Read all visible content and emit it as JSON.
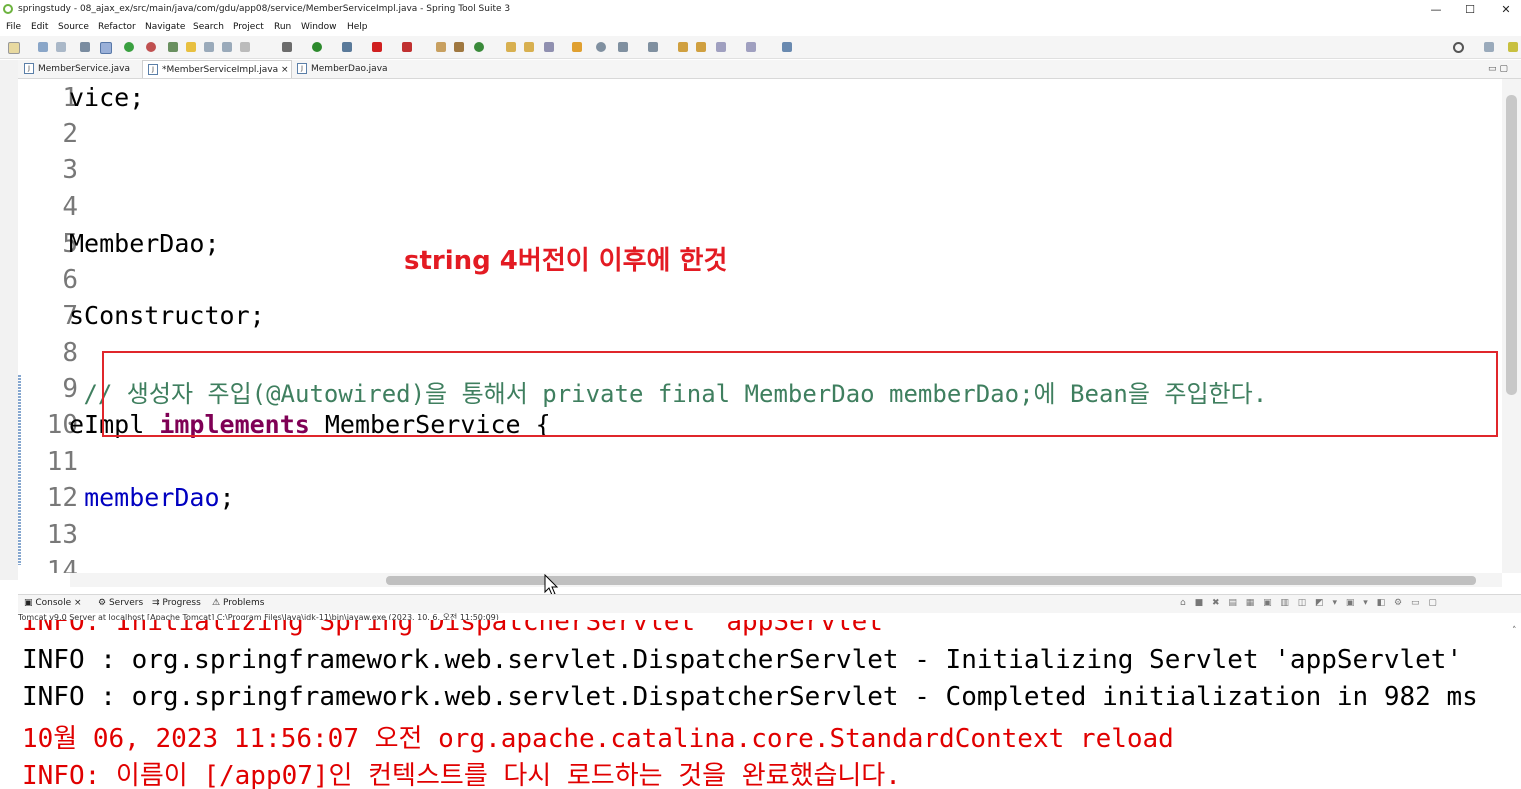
{
  "window": {
    "title": "springstudy - 08_ajax_ex/src/main/java/com/gdu/app08/service/MemberServiceImpl.java - Spring Tool Suite 3",
    "controls": [
      "—",
      "☐",
      "✕"
    ]
  },
  "menu": [
    "File",
    "Edit",
    "Source",
    "Refactor",
    "Navigate",
    "Search",
    "Project",
    "Run",
    "Window",
    "Help"
  ],
  "editor_tabs": [
    {
      "label": "MemberService.java",
      "active": false
    },
    {
      "label": "*MemberServiceImpl.java",
      "active": true,
      "close": "×"
    },
    {
      "label": "MemberDao.java",
      "active": false
    }
  ],
  "code_lines": [
    {
      "num": "1",
      "text": "vice;"
    },
    {
      "num": "2",
      "text": ""
    },
    {
      "num": "3",
      "text": ""
    },
    {
      "num": "4",
      "text": ""
    },
    {
      "num": "5",
      "text": "MemberDao;"
    },
    {
      "num": "6",
      "text": ""
    },
    {
      "num": "7",
      "text": "sConstructor;"
    },
    {
      "num": "8",
      "text": ""
    },
    {
      "num": "9",
      "text": " // 생성자 주입(@Autowired)을 통해서 private final MemberDao memberDao;에 Bean을 주입한다."
    },
    {
      "num": "10",
      "pre": "eImpl ",
      "kw": "implements",
      "post": " MemberService {"
    },
    {
      "num": "11",
      "text": ""
    },
    {
      "num": "12",
      "pre": " ",
      "fld": "memberDao",
      "post": ";"
    },
    {
      "num": "13",
      "text": ""
    },
    {
      "num": "14",
      "text": ""
    }
  ],
  "annotation": {
    "text": "string 4버전이 이후에 한것",
    "color": "#e31b23"
  },
  "console_tabs": [
    "Console",
    "Servers",
    "Progress",
    "Problems"
  ],
  "console_close": "×",
  "console_info": "Tomcat v9.0 Server at localhost [Apache Tomcat] C:\\Program Files\\Java\\jdk-11\\bin\\javaw.exe  (2023. 10. 6. 오전 11:50:09)",
  "console_lines": [
    {
      "text": "INFO: Initializing Spring DispatcherServlet 'appServlet'",
      "color": "red"
    },
    {
      "text": "INFO : org.springframework.web.servlet.DispatcherServlet - Initializing Servlet 'appServlet'",
      "color": "black"
    },
    {
      "text": "INFO : org.springframework.web.servlet.DispatcherServlet - Completed initialization in 982 ms",
      "color": "black"
    },
    {
      "text": "10월 06, 2023 11:56:07 오전 org.apache.catalina.core.StandardContext reload",
      "color": "red"
    },
    {
      "text": "INFO: 이름이 [/app07]인 컨텍스트를 다시 로드하는 것을 완료했습니다.",
      "color": "red"
    }
  ]
}
